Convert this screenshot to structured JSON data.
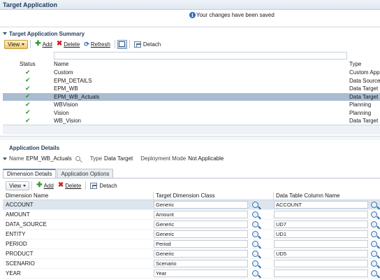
{
  "header": {
    "title": "Target Application",
    "saved_message": "Your changes have been saved"
  },
  "summary": {
    "title": "Target Application Summary",
    "toolbar": {
      "view_label": "View",
      "add_label": "Add",
      "delete_label": "Delete",
      "refresh_label": "Refresh",
      "detach_label": "Detach"
    },
    "columns": {
      "status": "Status",
      "name": "Name",
      "type": "Type"
    },
    "rows": [
      {
        "name": "Custom",
        "type": "Custom Appli"
      },
      {
        "name": "EPM_DETAILS",
        "type": "Data Source"
      },
      {
        "name": "EPM_WB",
        "type": "Data Target"
      },
      {
        "name": "EPM_WB_Actuals",
        "type": "Data Target"
      },
      {
        "name": "WBVision",
        "type": "Planning"
      },
      {
        "name": "Vision",
        "type": "Planning"
      },
      {
        "name": "WB_Vision",
        "type": "Data Target"
      }
    ],
    "selected_index": 3
  },
  "details": {
    "title": "Application Details",
    "name_label": "Name",
    "name_value": "EPM_WB_Actuals",
    "type_label": "Type",
    "type_value": "Data Target",
    "deployment_label": "Deployment Mode",
    "deployment_value": "Not Applicable",
    "tabs": [
      "Dimension Details",
      "Application Options"
    ],
    "toolbar": {
      "view_label": "View",
      "add_label": "Add",
      "delete_label": "Delete",
      "detach_label": "Detach"
    },
    "columns": {
      "dimension": "Dimension Name",
      "class": "Target Dimension Class",
      "column": "Data Table Column Name"
    },
    "rows": [
      {
        "dimension": "ACCOUNT",
        "class": "Generic",
        "column": "ACCOUNT"
      },
      {
        "dimension": "AMOUNT",
        "class": "Amount",
        "column": ""
      },
      {
        "dimension": "DATA_SOURCE",
        "class": "Generic",
        "column": "UD7"
      },
      {
        "dimension": "ENTITY",
        "class": "Generic",
        "column": "UD1"
      },
      {
        "dimension": "PERIOD",
        "class": "Period",
        "column": ""
      },
      {
        "dimension": "PRODUCT",
        "class": "Generic",
        "column": "UD5"
      },
      {
        "dimension": "SCENARIO",
        "class": "Scenario",
        "column": ""
      },
      {
        "dimension": "YEAR",
        "class": "Year",
        "column": ""
      }
    ]
  }
}
